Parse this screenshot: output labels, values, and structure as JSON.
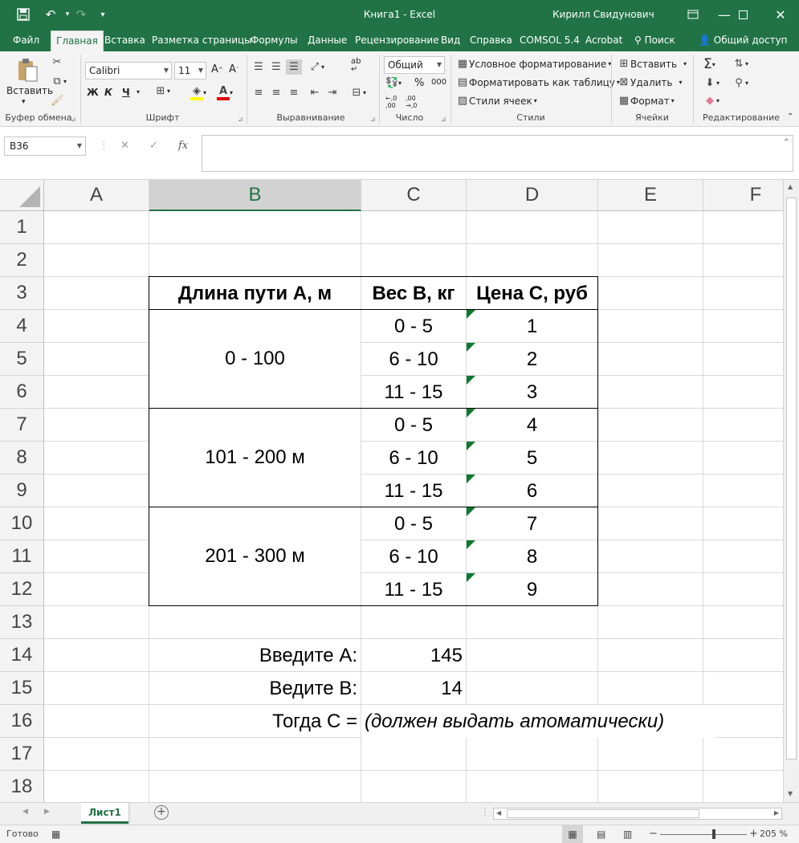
{
  "window": {
    "title": "Книга1  -  Excel",
    "user": "Кирилл Свидунович",
    "colors": {
      "brand": "#217346",
      "active_tab_text": "#217346",
      "comment_marker": "#0e7a2f"
    }
  },
  "quick_access": {
    "save_icon": "save-icon",
    "undo_icon": "undo-icon",
    "redo_icon": "redo-icon",
    "customize_icon": "customize-icon"
  },
  "tabs": [
    {
      "label": "Файл"
    },
    {
      "label": "Главная",
      "active": true
    },
    {
      "label": "Вставка"
    },
    {
      "label": "Разметка страницы"
    },
    {
      "label": "Формулы"
    },
    {
      "label": "Данные"
    },
    {
      "label": "Рецензирование"
    },
    {
      "label": "Вид"
    },
    {
      "label": "Справка"
    },
    {
      "label": "COMSOL 5.4"
    },
    {
      "label": "Acrobat"
    },
    {
      "label": "Поиск"
    },
    {
      "label": "Общий доступ"
    }
  ],
  "ribbon": {
    "groups": {
      "clipboard": "Буфер обмена",
      "font": "Шрифт",
      "alignment": "Выравнивание",
      "number": "Число",
      "styles": "Стили",
      "cells": "Ячейки",
      "editing": "Редактирование"
    },
    "paste_label": "Вставить",
    "font_name": "Calibri",
    "font_size": "11",
    "bold": "Ж",
    "italic": "К",
    "underline": "Ч",
    "number_format": "Общий",
    "percent": "%",
    "thousands": "000",
    "cond_format": "Условное форматирование",
    "format_table": "Форматировать как таблицу",
    "cell_styles": "Стили ячеек",
    "insert": "Вставить",
    "delete": "Удалить",
    "format": "Формат"
  },
  "formula_bar": {
    "name_box": "B36",
    "fx": "fx",
    "value": ""
  },
  "columns": [
    "A",
    "B",
    "C",
    "D",
    "E",
    "F"
  ],
  "selected_column": "B",
  "rows": [
    "1",
    "2",
    "3",
    "4",
    "5",
    "6",
    "7",
    "8",
    "9",
    "10",
    "11",
    "12",
    "13",
    "14",
    "15",
    "16",
    "17",
    "18"
  ],
  "table": {
    "headers": [
      "Длина пути А, м",
      "Вес В, кг",
      "Цена С, руб"
    ],
    "groups": [
      {
        "range": "0 - 100",
        "items": [
          {
            "weight": "0 - 5",
            "price": "1"
          },
          {
            "weight": "6 - 10",
            "price": "2"
          },
          {
            "weight": "11 - 15",
            "price": "3"
          }
        ]
      },
      {
        "range": "101 - 200 м",
        "items": [
          {
            "weight": "0 - 5",
            "price": "4"
          },
          {
            "weight": "6 - 10",
            "price": "5"
          },
          {
            "weight": "11 - 15",
            "price": "6"
          }
        ]
      },
      {
        "range": "201 - 300 м",
        "items": [
          {
            "weight": "0 - 5",
            "price": "7"
          },
          {
            "weight": "6 - 10",
            "price": "8"
          },
          {
            "weight": "11 - 15",
            "price": "9"
          }
        ]
      }
    ]
  },
  "inputs": {
    "a_label": "Введите А:",
    "a_value": "145",
    "b_label": "Ведите В:",
    "b_value": "14",
    "c_label": "Тогда С =",
    "c_note": "(должен выдать атоматически)"
  },
  "sheets": [
    {
      "name": "Лист1",
      "active": true
    }
  ],
  "status": {
    "ready": "Готово",
    "zoom": "205 %",
    "zoom_minus": "−",
    "zoom_plus": "+"
  }
}
